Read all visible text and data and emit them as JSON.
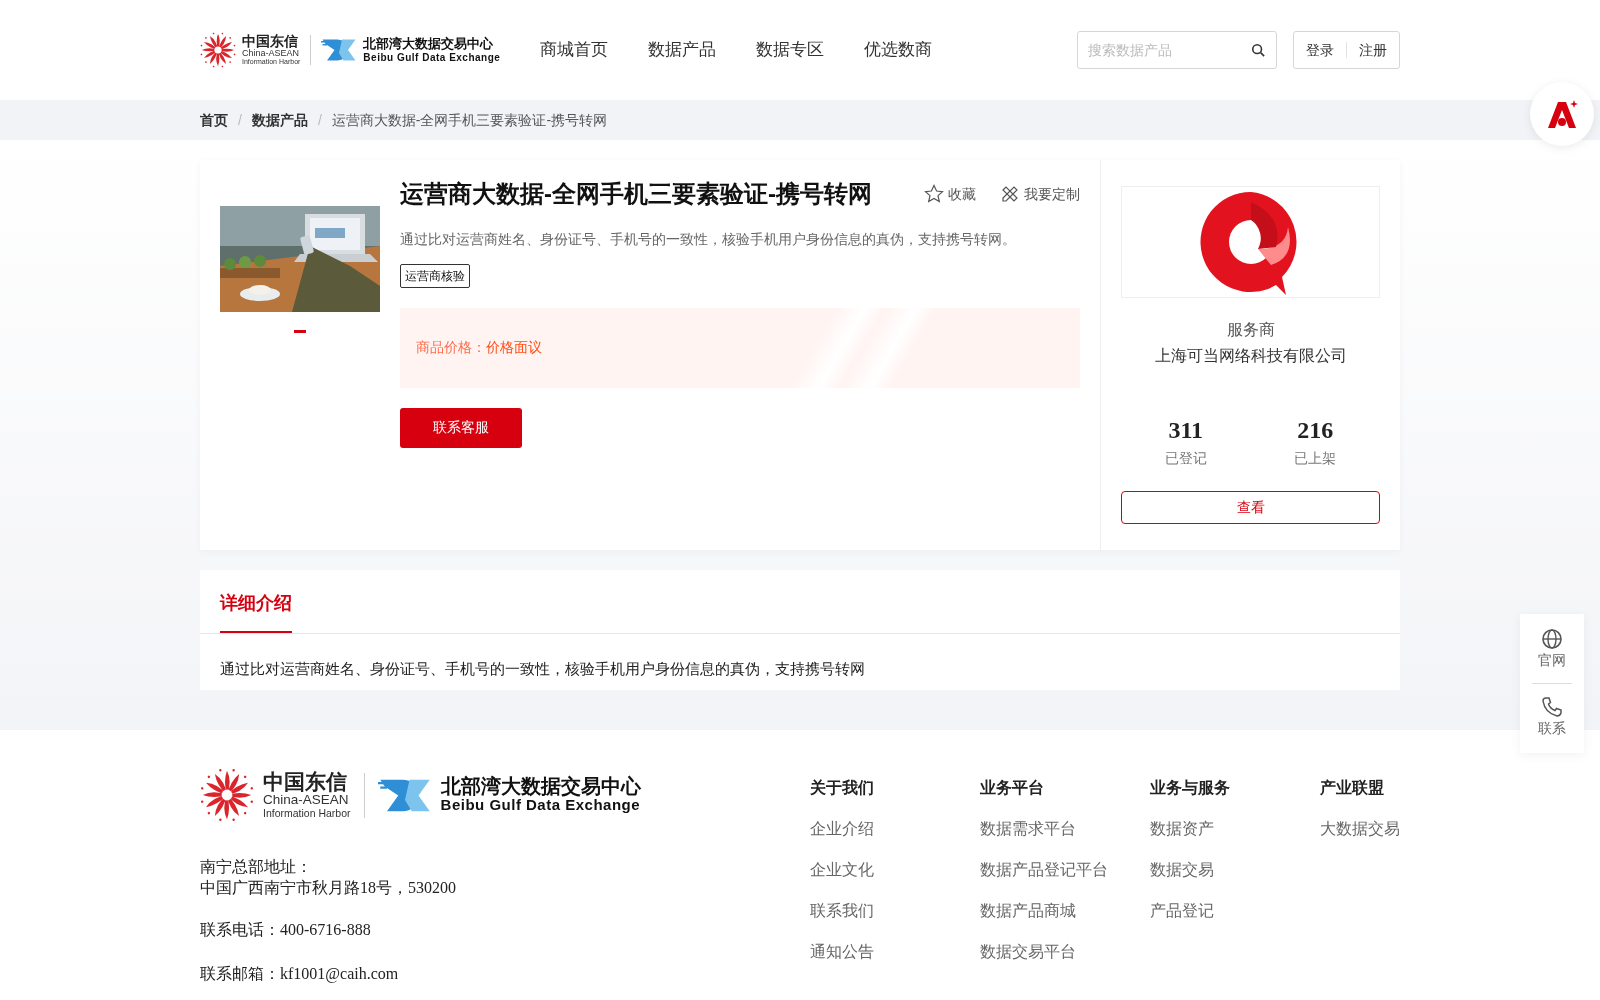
{
  "header": {
    "logo": {
      "cn": "中国东信",
      "en1": "China-ASEAN",
      "en2": "Information Harbor",
      "exchange_cn": "北部湾大数据交易中心",
      "exchange_en": "Beibu Gulf Data Exchange"
    },
    "nav": [
      "商城首页",
      "数据产品",
      "数据专区",
      "优选数商"
    ],
    "search": {
      "placeholder": "搜索数据产品"
    },
    "auth": [
      "登录",
      "注册"
    ]
  },
  "breadcrumb": {
    "separator": "/",
    "items": [
      "首页",
      "数据产品",
      "运营商大数据-全网手机三要素验证-携号转网"
    ]
  },
  "product": {
    "slides": [
      {
        "selected": true
      }
    ],
    "title": "运营商大数据-全网手机三要素验证-携号转网",
    "actions": [
      {
        "kind": "star",
        "label": "收藏"
      },
      {
        "kind": "pencil",
        "label": "我要定制"
      }
    ],
    "description": "通过比对运营商姓名、身份证号、手机号的一致性，核验手机用户身份信息的真伪，支持携号转网。",
    "tags": [
      "运营商核验"
    ],
    "price_label": "商品价格：",
    "price": "价格面议",
    "contact_button": "联系客服"
  },
  "provider": {
    "role": "服务商",
    "name": "上海可当网络科技有限公司",
    "stats": [
      {
        "value": "311",
        "label": "已登记"
      },
      {
        "value": "216",
        "label": "已上架"
      }
    ],
    "button": "查看"
  },
  "detail": {
    "tabs": [
      {
        "label": "详细介绍",
        "selected": true
      }
    ],
    "text": "通过比对运营商姓名、身份证号、手机号的一致性，核验手机用户身份信息的真伪，支持携号转网"
  },
  "footer": {
    "logo": {
      "cn": "中国东信",
      "en1": "China-ASEAN",
      "en2": "Information Harbor",
      "exchange_cn": "北部湾大数据交易中心",
      "exchange_en": "Beibu Gulf Data Exchange"
    },
    "address_label": "南宁总部地址：",
    "address": "中国广西南宁市秋月路18号，530200",
    "phone": "联系电话：400-6716-888",
    "email": "联系邮箱：kf1001@caih.com",
    "columns": [
      {
        "title": "关于我们",
        "links": [
          "企业介绍",
          "企业文化",
          "联系我们",
          "通知公告"
        ]
      },
      {
        "title": "业务平台",
        "links": [
          "数据需求平台",
          "数据产品登记平台",
          "数据产品商城",
          "数据交易平台"
        ]
      },
      {
        "title": "业务与服务",
        "links": [
          "数据资产",
          "数据交易",
          "产品登记"
        ]
      },
      {
        "title": "产业联盟",
        "links": [
          "大数据交易"
        ]
      }
    ]
  },
  "side_panel": [
    {
      "kind": "globe",
      "label": "官网"
    },
    {
      "kind": "phone",
      "label": "联系"
    }
  ]
}
